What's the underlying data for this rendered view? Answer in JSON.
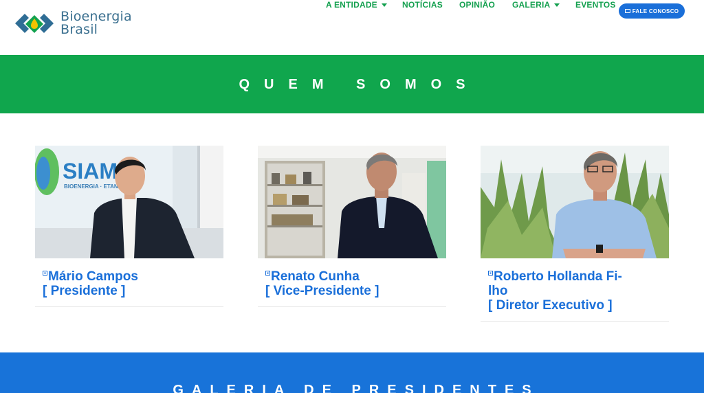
{
  "brand": {
    "line1": "Bioenergia",
    "line2": "Brasil"
  },
  "nav": {
    "items": [
      {
        "label": "A ENTIDADE",
        "has_dropdown": true
      },
      {
        "label": "NOTÍCIAS",
        "has_dropdown": false
      },
      {
        "label": "OPINIÃO",
        "has_dropdown": false
      },
      {
        "label": "GALERIA",
        "has_dropdown": true
      },
      {
        "label": "EVENTOS",
        "has_dropdown": false
      }
    ],
    "cta_label": "FALE CONOSCO"
  },
  "hero": {
    "title": "QUEM SOMOS"
  },
  "team": [
    {
      "name": "Mário Campos",
      "name_line2": "",
      "role": "[ Presidente ]",
      "photo_sign": "SIAMI",
      "photo_sign_sub": "BIOENERGIA · ETANOL ·"
    },
    {
      "name": "Renato Cunha",
      "name_line2": "",
      "role": "[ Vice-Presidente ]"
    },
    {
      "name": "Roberto Hollanda Fi-",
      "name_line2": "lho",
      "role": "[ Diretor Executivo ]"
    }
  ],
  "gallery": {
    "title": "GALERIA DE PRESIDENTES"
  },
  "colors": {
    "green": "#10a64d",
    "blue": "#1873d9",
    "link_blue": "#1a6fd9",
    "nav_green": "#14a04f"
  }
}
